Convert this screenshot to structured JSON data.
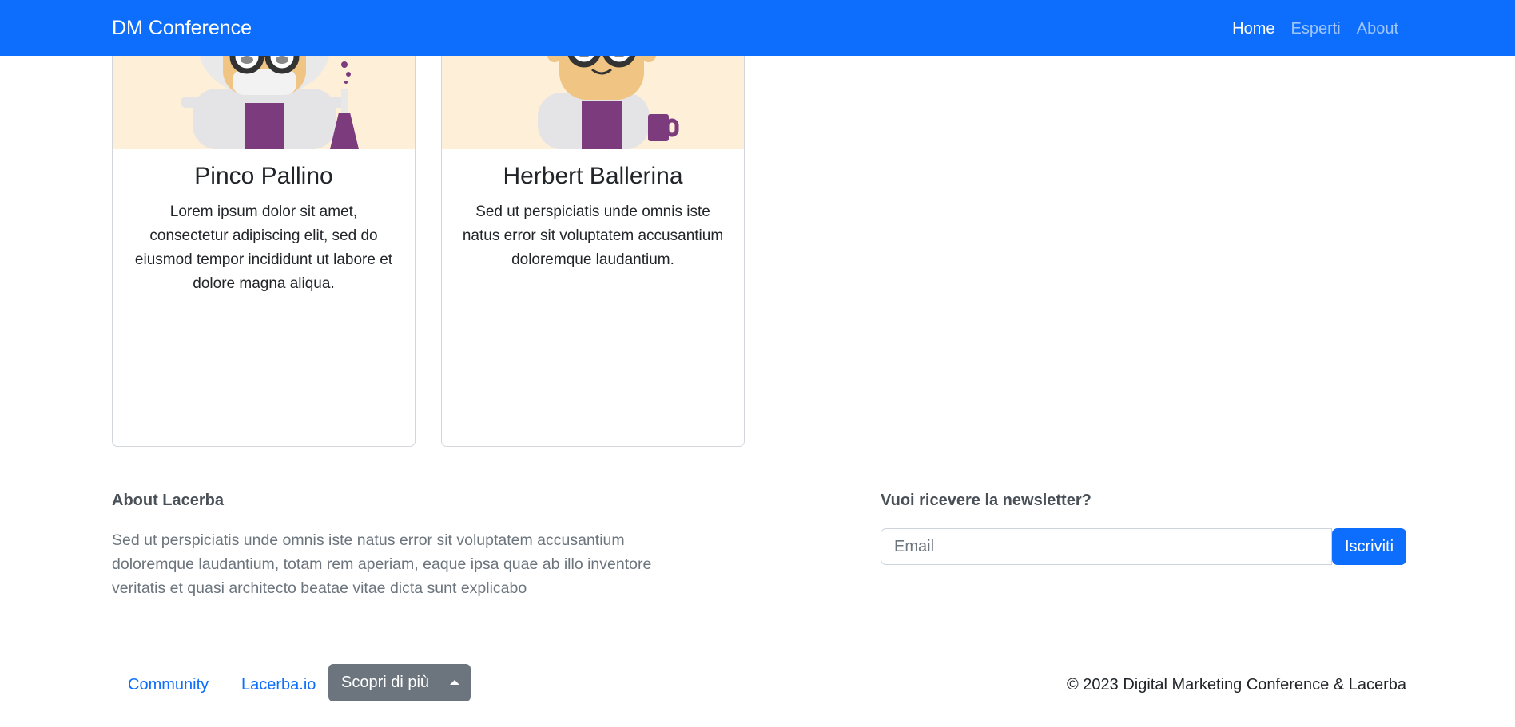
{
  "navbar": {
    "brand": "DM Conference",
    "links": [
      {
        "label": "Home",
        "active": true
      },
      {
        "label": "Esperti",
        "active": false
      },
      {
        "label": "About",
        "active": false
      }
    ]
  },
  "cards": [
    {
      "name": "Pinco Pallino",
      "text": "Lorem ipsum dolor sit amet, consectetur adipiscing elit, sed do eiusmod tempor incididunt ut labore et dolore magna aliqua."
    },
    {
      "name": "Herbert Ballerina",
      "text": "Sed ut perspiciatis unde omnis iste natus error sit voluptatem accusantium doloremque laudantium."
    }
  ],
  "footer": {
    "about_title": "About Lacerba",
    "about_text": "Sed ut perspiciatis unde omnis iste natus error sit voluptatem accusantium doloremque laudantium, totam rem aperiam, eaque ipsa quae ab illo inventore veritatis et quasi architecto beatae vitae dicta sunt explicabo",
    "newsletter_title": "Vuoi ricevere la newsletter?",
    "email_placeholder": "Email",
    "subscribe_label": "Iscriviti",
    "links": [
      "Community",
      "Lacerba.io"
    ],
    "dropdown_label": "Scopri di più",
    "copyright": "© 2023 Digital Marketing Conference & Lacerba"
  },
  "colors": {
    "primary": "#0d6efd",
    "secondary": "#6c757d",
    "card_image_bg": "#feefd8",
    "coat_purple": "#7b3b7c"
  },
  "icons": [
    "scientist-illustration",
    "scientist-illustration",
    "caret-up-icon"
  ]
}
